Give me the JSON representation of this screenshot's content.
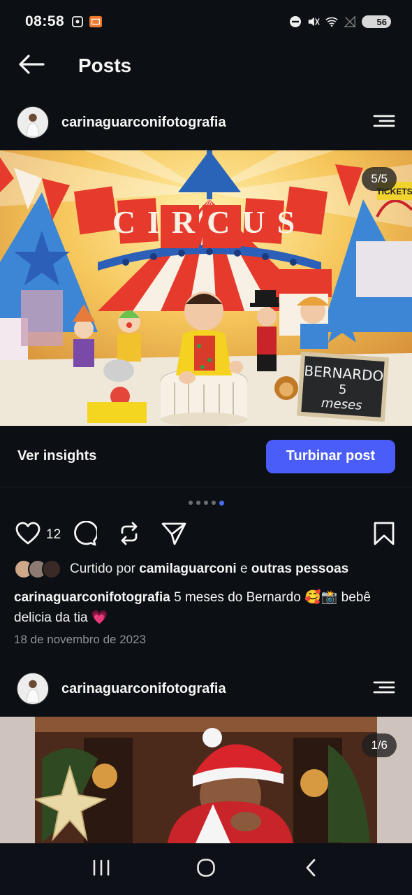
{
  "status_bar": {
    "time": "08:58",
    "battery": "56"
  },
  "header": {
    "title": "Posts"
  },
  "posts": [
    {
      "username": "carinaguarconifotografia",
      "counter": "5/5",
      "insights_label": "Ver insights",
      "boost_label": "Turbinar post",
      "carousel_total": 5,
      "carousel_active": 5,
      "like_count": "12",
      "liked_by_prefix": "Curtido por",
      "liked_by_user": "camilaguarconi",
      "liked_by_joiner": "e",
      "liked_by_others": "outras pessoas",
      "caption_user": "carinaguarconifotografia",
      "caption_text": "5 meses do Bernardo 🥰📸 bebê delicia da tia 💗",
      "date": "18 de novembro de 2023",
      "sign_text_1": "BERNARDO",
      "sign_text_2": "5",
      "sign_text_3": "meses",
      "banner_text": "CIRCUS",
      "ticket_text": "TICKETS"
    },
    {
      "username": "carinaguarconifotografia",
      "counter": "1/6"
    }
  ],
  "colors": {
    "background": "#0c1014",
    "accent": "#4a5df9",
    "heart": "#ff3b6b"
  },
  "icons": {
    "back": "arrow-left",
    "menu": "menu-lines",
    "like": "heart-outline",
    "comment": "speech-bubble",
    "repost": "repost-arrows",
    "share": "paper-plane",
    "save": "bookmark-outline"
  }
}
